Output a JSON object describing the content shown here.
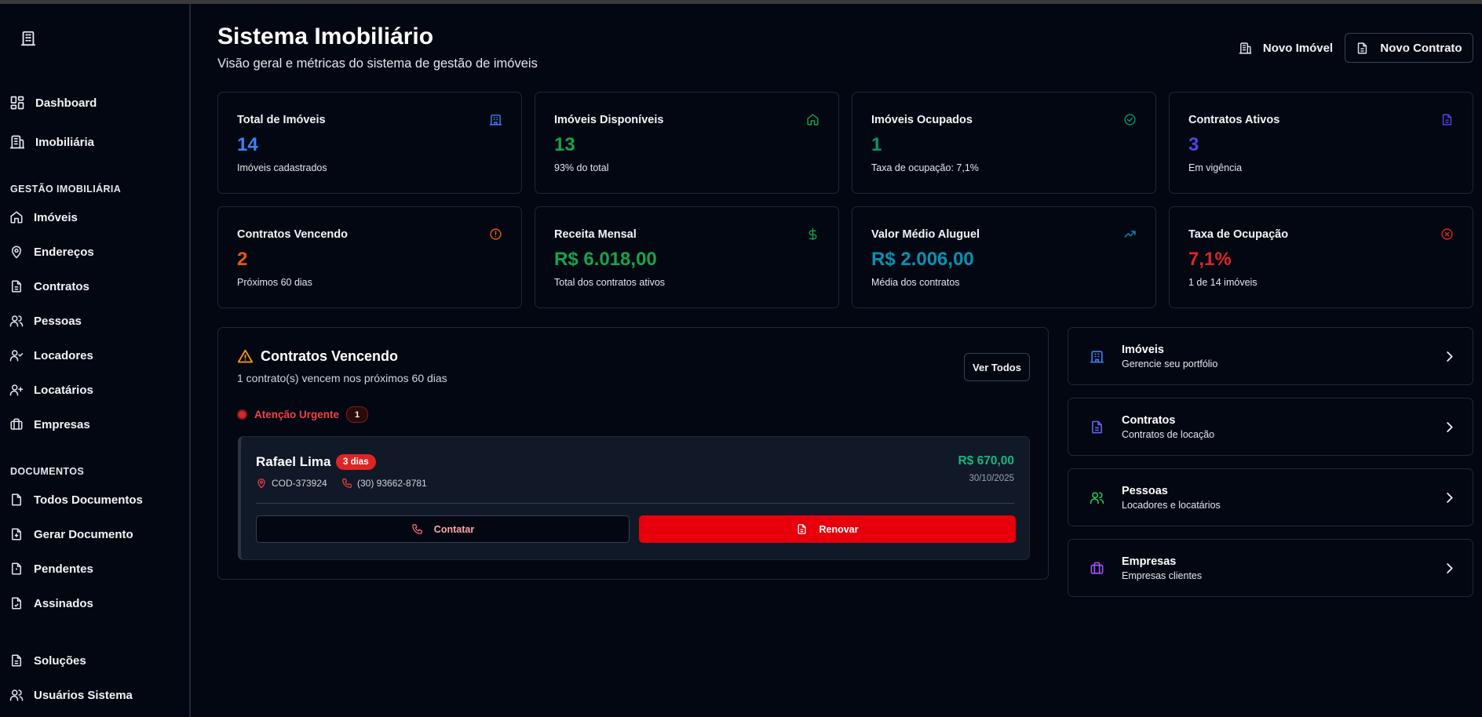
{
  "header": {
    "title": "Sistema Imobiliário",
    "subtitle": "Visão geral e métricas do sistema de gestão de imóveis",
    "btn_novo_imovel": "Novo Imóvel",
    "btn_novo_contrato": "Novo Contrato"
  },
  "sidebar": {
    "top_items": [
      {
        "label": "Dashboard",
        "icon": "dashboard-icon"
      },
      {
        "label": "Imobiliária",
        "icon": "building-icon"
      }
    ],
    "section1_title": "GESTÃO IMOBILIÁRIA",
    "section1_items": [
      {
        "label": "Imóveis",
        "icon": "home-icon"
      },
      {
        "label": "Endereços",
        "icon": "map-pin-icon"
      },
      {
        "label": "Contratos",
        "icon": "file-icon"
      },
      {
        "label": "Pessoas",
        "icon": "users-icon"
      },
      {
        "label": "Locadores",
        "icon": "user-check-icon"
      },
      {
        "label": "Locatários",
        "icon": "user-plus-icon"
      },
      {
        "label": "Empresas",
        "icon": "briefcase-icon"
      }
    ],
    "section2_title": "DOCUMENTOS",
    "section2_items": [
      {
        "label": "Todos Documentos",
        "icon": "file-icon"
      },
      {
        "label": "Gerar Documento",
        "icon": "file-plus-icon"
      },
      {
        "label": "Pendentes",
        "icon": "file-alert-icon"
      },
      {
        "label": "Assinados",
        "icon": "file-check-icon"
      }
    ],
    "bottom_items": [
      {
        "label": "Soluções",
        "icon": "file-text-icon"
      },
      {
        "label": "Usuários Sistema",
        "icon": "users-icon"
      }
    ]
  },
  "stats": [
    {
      "title": "Total de Imóveis",
      "value": "14",
      "sub": "Imóveis cadastrados",
      "color": "#3b82f6",
      "icon": "building-icon"
    },
    {
      "title": "Imóveis Disponíveis",
      "value": "13",
      "sub": "93% do total",
      "color": "#16a34a",
      "icon": "home-icon"
    },
    {
      "title": "Imóveis Ocupados",
      "value": "1",
      "sub": "Taxa de ocupação: 7,1%",
      "color": "#059669",
      "icon": "check-circle-icon"
    },
    {
      "title": "Contratos Ativos",
      "value": "3",
      "sub": "Em vigência",
      "color": "#4f46e5",
      "icon": "file-text-icon"
    },
    {
      "title": "Contratos Vencendo",
      "value": "2",
      "sub": "Próximos 60 dias",
      "color": "#ea580c",
      "icon": "alert-circle-icon"
    },
    {
      "title": "Receita Mensal",
      "value": "R$ 6.018,00",
      "sub": "Total dos contratos ativos",
      "color": "#16a34a",
      "icon": "dollar-icon"
    },
    {
      "title": "Valor Médio Aluguel",
      "value": "R$ 2.006,00",
      "sub": "Média dos contratos",
      "color": "#0891b2",
      "icon": "trending-up-icon"
    },
    {
      "title": "Taxa de Ocupação",
      "value": "7,1%",
      "sub": "1 de 14 imóveis",
      "color": "#dc2626",
      "icon": "x-circle-icon"
    }
  ],
  "expiring": {
    "title": "Contratos Vencendo",
    "subtitle": "1 contrato(s) vencem nos próximos 60 dias",
    "ver_todos": "Ver Todos",
    "urgent_label": "Atenção Urgente",
    "urgent_count": "1",
    "contract": {
      "name": "Rafael Lima",
      "badge": "3 dias",
      "code": "COD-373924",
      "phone": "(30) 93662-8781",
      "value": "R$ 670,00",
      "date": "30/10/2025",
      "btn_contatar": "Contatar",
      "btn_renovar": "Renovar"
    }
  },
  "quick_links": [
    {
      "title": "Imóveis",
      "sub": "Gerencie seu portfólio",
      "color": "#3b82f6",
      "icon": "building-icon"
    },
    {
      "title": "Contratos",
      "sub": "Contratos de locação",
      "color": "#6366f1",
      "icon": "file-text-icon"
    },
    {
      "title": "Pessoas",
      "sub": "Locadores e locatários",
      "color": "#22c55e",
      "icon": "users-icon"
    },
    {
      "title": "Empresas",
      "sub": "Empresas clientes",
      "color": "#a855f7",
      "icon": "briefcase-icon"
    }
  ]
}
